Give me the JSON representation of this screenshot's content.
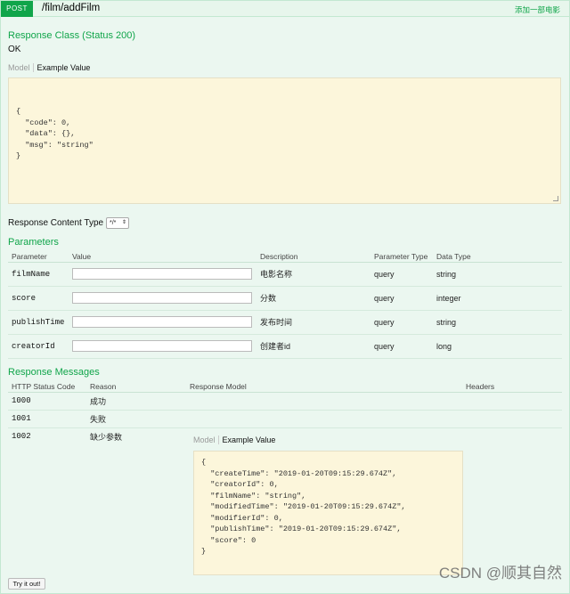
{
  "operation": {
    "method": "POST",
    "path": "/film/addFilm",
    "summary": "添加一部电影"
  },
  "response_class": {
    "title": "Response Class (Status 200)",
    "status_text": "OK",
    "tab_model": "Model",
    "tab_example": "Example Value",
    "example_lines": [
      "{",
      "  \"code\": 0,",
      "  \"data\": {},",
      "  \"msg\": \"string\"",
      "}"
    ]
  },
  "content_type": {
    "label": "Response Content Type",
    "selected": "*/*"
  },
  "parameters": {
    "title": "Parameters",
    "headers": [
      "Parameter",
      "Value",
      "Description",
      "Parameter Type",
      "Data Type"
    ],
    "rows": [
      {
        "name": "filmName",
        "value": "",
        "description": "电影名称",
        "param_type": "query",
        "data_type": "string"
      },
      {
        "name": "score",
        "value": "",
        "description": "分数",
        "param_type": "query",
        "data_type": "integer"
      },
      {
        "name": "publishTime",
        "value": "",
        "description": "发布时间",
        "param_type": "query",
        "data_type": "string"
      },
      {
        "name": "creatorId",
        "value": "",
        "description": "创建者id",
        "param_type": "query",
        "data_type": "long"
      }
    ]
  },
  "response_messages": {
    "title": "Response Messages",
    "headers": [
      "HTTP Status Code",
      "Reason",
      "Response Model",
      "Headers"
    ],
    "rows": [
      {
        "code": "1000",
        "reason": "成功"
      },
      {
        "code": "1001",
        "reason": "失败"
      },
      {
        "code": "1002",
        "reason": "缺少参数"
      }
    ],
    "model_tab": "Model",
    "example_tab": "Example Value",
    "example_lines": [
      "{",
      "  \"createTime\": \"2019-01-20T09:15:29.674Z\",",
      "  \"creatorId\": 0,",
      "  \"filmName\": \"string\",",
      "  \"modifiedTime\": \"2019-01-20T09:15:29.674Z\",",
      "  \"modifierId\": 0,",
      "  \"publishTime\": \"2019-01-20T09:15:29.674Z\",",
      "  \"score\": 0",
      "}"
    ]
  },
  "try_button": "Try it out!",
  "watermark": "CSDN @顺其自然"
}
